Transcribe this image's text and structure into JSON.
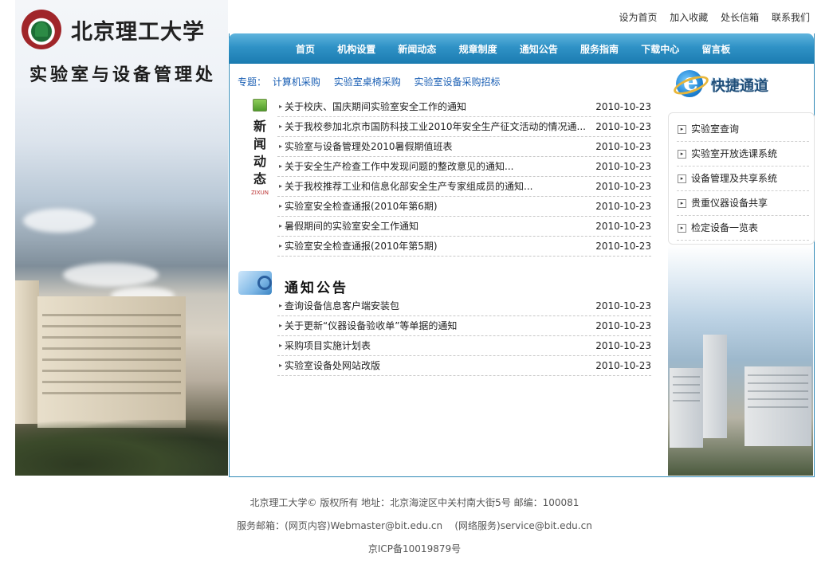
{
  "header": {
    "university_name": "北京理工大学",
    "department_name": "实验室与设备管理处"
  },
  "top_links": [
    "设为首页",
    "加入收藏",
    "处长信箱",
    "联系我们"
  ],
  "nav": [
    "首页",
    "机构设置",
    "新闻动态",
    "规章制度",
    "通知公告",
    "服务指南",
    "下载中心",
    "留言板"
  ],
  "topics": {
    "label": "专题：",
    "links": [
      "计算机采购",
      "实验室桌椅采购",
      "实验室设备采购招标"
    ]
  },
  "news_section": {
    "title_chars": [
      "新",
      "闻",
      "动",
      "态"
    ],
    "en": "ZIXUN",
    "items": [
      {
        "title": "关于校庆、国庆期间实验室安全工作的通知",
        "date": "2010-10-23"
      },
      {
        "title": "关于我校参加北京市国防科技工业2010年安全生产征文活动的情况通...",
        "date": "2010-10-23"
      },
      {
        "title": "实验室与设备管理处2010暑假期值班表",
        "date": "2010-10-23"
      },
      {
        "title": "关于安全生产检查工作中发现问题的整改意见的通知...",
        "date": "2010-10-23"
      },
      {
        "title": "关于我校推荐工业和信息化部安全生产专家组成员的通知...",
        "date": "2010-10-23"
      },
      {
        "title": "实验室安全检查通报(2010年第6期)",
        "date": "2010-10-23"
      },
      {
        "title": "暑假期间的实验室安全工作通知",
        "date": "2010-10-23"
      },
      {
        "title": "实验室安全检查通报(2010年第5期)",
        "date": "2010-10-23"
      }
    ]
  },
  "notice_section": {
    "title": "通知公告",
    "items": [
      {
        "title": "查询设备信息客户端安装包",
        "date": "2010-10-23"
      },
      {
        "title": "关于更新“仪器设备验收单”等单据的通知",
        "date": "2010-10-23"
      },
      {
        "title": "采购项目实施计划表",
        "date": "2010-10-23"
      },
      {
        "title": "实验室设备处网站改版",
        "date": "2010-10-23"
      }
    ]
  },
  "quick_access": {
    "title": "快捷通道",
    "items": [
      "实验室查询",
      "实验室开放选课系统",
      "设备管理及共享系统",
      "贵重仪器设备共享",
      "检定设备一览表"
    ]
  },
  "footer": {
    "line1": "北京理工大学© 版权所有 地址：北京海淀区中关村南大街5号 邮编：100081",
    "line2": "服务邮箱：(网页内容)Webmaster@bit.edu.cn    (网络服务)service@bit.edu.cn",
    "line3": "京ICP备10019879号"
  }
}
